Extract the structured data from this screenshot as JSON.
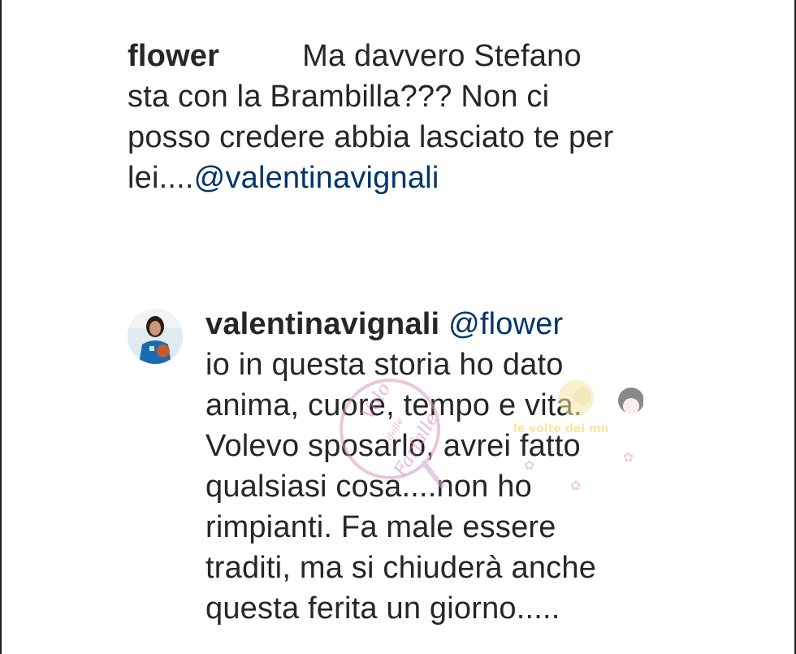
{
  "comment": {
    "username": "flower",
    "text_line1": "Ma davvero Stefano",
    "text_line2": "sta con la Brambilla??? Non ci",
    "text_line3": "posso credere abbia lasciato te per",
    "text_line4_prefix": "lei....",
    "mention": "@valentinavignali"
  },
  "reply": {
    "username": "valentinavignali",
    "mention": "@flower",
    "lines": [
      "io in questa storia ho dato",
      "anima, cuore, tempo e vita.",
      "Volevo sposarlo, avrei fatto",
      "qualsiasi cosa....non ho",
      "rimpianti. Fa male essere",
      "traditi, ma si chiuderà anche",
      "questa ferita un giorno....."
    ]
  },
  "watermark": {
    "logo_text": "Volo delle Farfalle",
    "banner_text": "le volte dei mn"
  },
  "colors": {
    "text": "#262626",
    "mention": "#003569",
    "avatar_bg": "#d9e7ef",
    "avatar_shirt": "#1b6bb0"
  }
}
